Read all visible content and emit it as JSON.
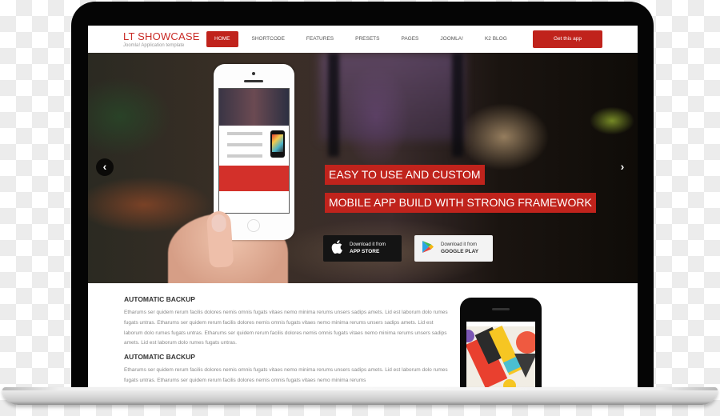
{
  "site": {
    "logo": "LT SHOWCASE",
    "tagline": "Joomla! Application template"
  },
  "nav": {
    "items": [
      {
        "label": "HOME",
        "active": true
      },
      {
        "label": "SHORTCODE",
        "active": false
      },
      {
        "label": "FEATURES",
        "active": false
      },
      {
        "label": "PRESETS",
        "active": false
      },
      {
        "label": "PAGES",
        "active": false
      },
      {
        "label": "JOOMLA!",
        "active": false
      },
      {
        "label": "K2 BLOG",
        "active": false
      }
    ],
    "cta_label": "Get this app"
  },
  "hero": {
    "caption_1": "EASY TO USE AND CUSTOM",
    "caption_2": "MOBILE APP BUILD WITH STRONG FRAMEWORK",
    "prev_icon": "‹",
    "next_icon": "›",
    "app_store": {
      "small": "Download it from",
      "big": "APP STORE",
      "icon": ""
    },
    "google_play": {
      "small": "Download it from",
      "big": "GOOGLE PLAY",
      "icon": "▶"
    }
  },
  "content": {
    "sections": [
      {
        "title": "AUTOMATIC BACKUP",
        "body": "Etharums ser quidem rerum facilis dolores nemis omnis fugats vitaes nemo minima rerums unsers sadips amets. Lid est laborum dolo rumes fugats untras. Etharums ser quidem rerum facilis dolores nemis omnis fugats vitaes nemo minima rerums unsers sadips amets. Lid est laborum dolo rumes fugats untras. Etharums ser quidem rerum facilis dolores nemis omnis fugats vitaes nemo minima rerums unsers sadips amets. Lid est laborum dolo rumes fugats untras."
      },
      {
        "title": "AUTOMATIC BACKUP",
        "body": "Etharums ser quidem rerum facilis dolores nemis omnis fugats vitaes nemo minima rerums unsers sadips amets. Lid est laborum dolo rumes fugats untras. Etharums ser quidem rerum facilis dolores nemis omnis fugats vitaes nemo minima rerums"
      }
    ]
  },
  "colors": {
    "brand_red": "#c0231c",
    "logo_red": "#c92a25"
  }
}
